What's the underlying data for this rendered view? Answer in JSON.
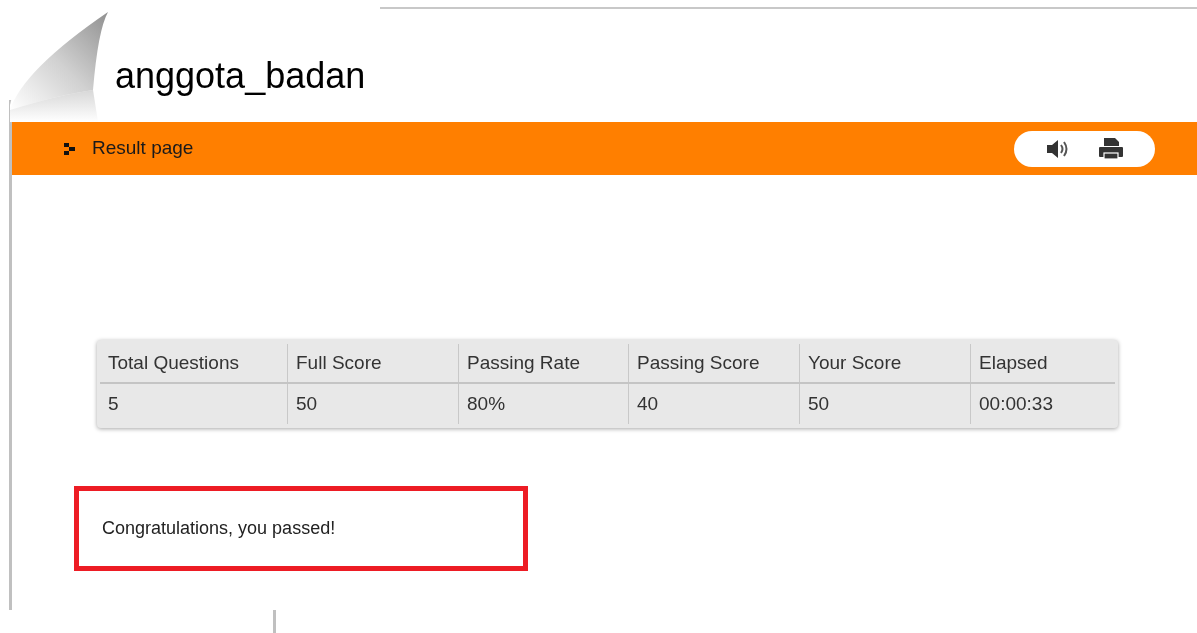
{
  "title": "anggota_badan",
  "toolbar": {
    "label": "Result page"
  },
  "table": {
    "columns": [
      "Total Questions",
      "Full Score",
      "Passing Rate",
      "Passing Score",
      "Your Score",
      "Elapsed"
    ],
    "rows": [
      [
        "5",
        "50",
        "80%",
        "40",
        "50",
        "00:00:33"
      ]
    ]
  },
  "message": "Congratulations, you passed!"
}
